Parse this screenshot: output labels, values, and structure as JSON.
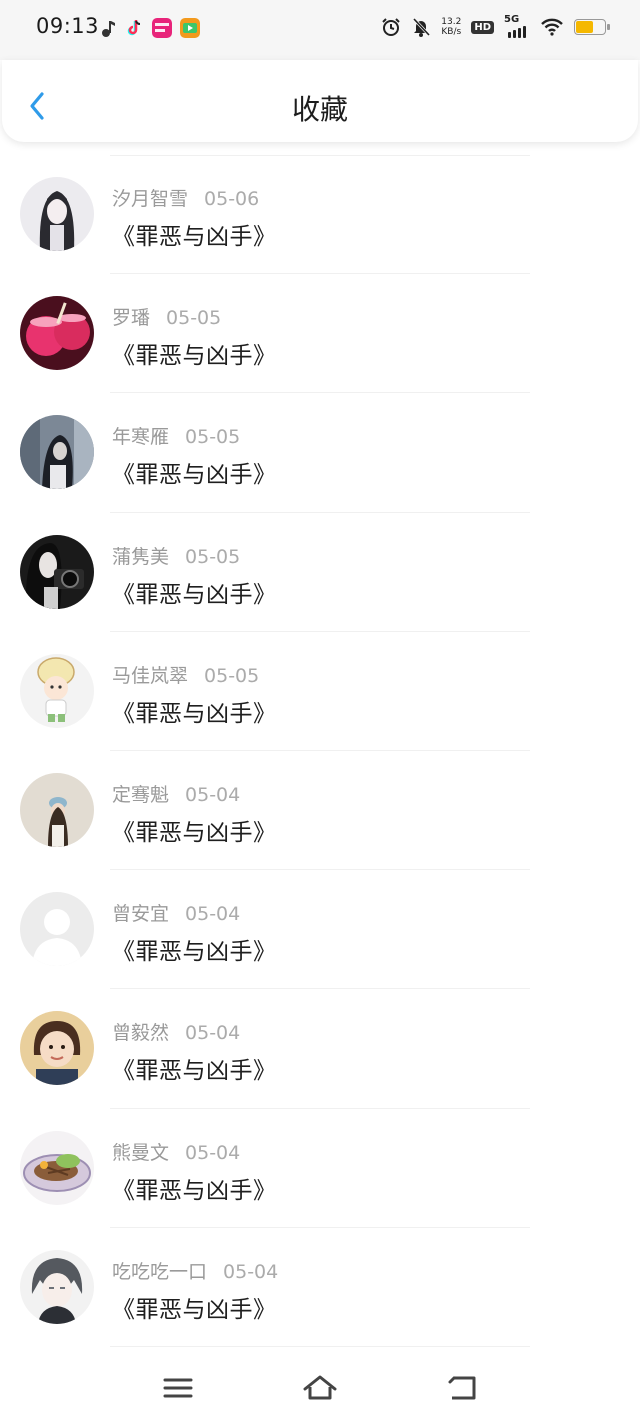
{
  "status_bar": {
    "time": "09:13",
    "net_speed_value": "13.2",
    "net_speed_unit": "KB/s",
    "hd": "HD",
    "network": "5G",
    "battery_color": "#f5b800"
  },
  "header": {
    "title": "收藏",
    "accent_color": "#2f9be9"
  },
  "favorites": [
    {
      "name": "汐月智雪",
      "date": "05-06",
      "book": "《罪恶与凶手》"
    },
    {
      "name": "罗璠",
      "date": "05-05",
      "book": "《罪恶与凶手》"
    },
    {
      "name": "年寒雁",
      "date": "05-05",
      "book": "《罪恶与凶手》"
    },
    {
      "name": "蒲隽美",
      "date": "05-05",
      "book": "《罪恶与凶手》"
    },
    {
      "name": "马佳岚翠",
      "date": "05-05",
      "book": "《罪恶与凶手》"
    },
    {
      "name": "定骞魁",
      "date": "05-04",
      "book": "《罪恶与凶手》"
    },
    {
      "name": "曾安宜",
      "date": "05-04",
      "book": "《罪恶与凶手》"
    },
    {
      "name": "曾毅然",
      "date": "05-04",
      "book": "《罪恶与凶手》"
    },
    {
      "name": "熊曼文",
      "date": "05-04",
      "book": "《罪恶与凶手》"
    },
    {
      "name": "吃吃吃一口",
      "date": "05-04",
      "book": "《罪恶与凶手》"
    }
  ],
  "nav_bar": {
    "menu_icon": "menu-icon",
    "home_icon": "home-icon",
    "back_icon": "back-icon"
  }
}
